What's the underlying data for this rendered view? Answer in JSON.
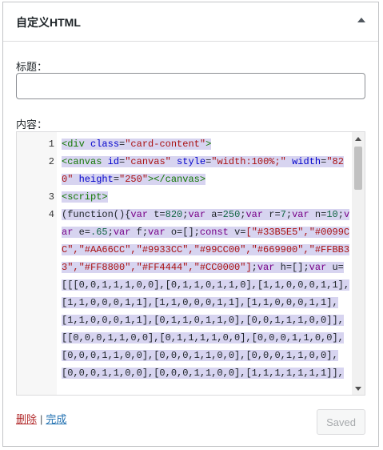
{
  "widget": {
    "title": "自定义HTML",
    "title_label": "标题：",
    "title_value": "",
    "content_label": "内容：",
    "delete_label": "删除",
    "separator": "|",
    "done_label": "完成",
    "saved_label": "Saved"
  },
  "editor": {
    "line_numbers": [
      "1",
      "2",
      "3",
      "4"
    ],
    "line1": {
      "open": "<",
      "tag": "div",
      "attr": "class",
      "eq": "=",
      "str": "\"card-content\"",
      "close": ">"
    },
    "line2": {
      "open": "<",
      "tag": "canvas",
      "attr1": "id",
      "eq1": "=",
      "str1": "\"canvas\"",
      "attr2": "style",
      "eq2": "=",
      "str2": "\"width:100%;\"",
      "attr3": "width",
      "eq3": "=",
      "str3": "\"820\"",
      "attr4": "height",
      "eq4": "=",
      "str4": "\"250\"",
      "close": ">",
      "end": "</canvas>"
    },
    "line3": {
      "text": "<script>"
    },
    "line4": {
      "a": "(function(){",
      "kw1": "var",
      "b": " t=",
      "n1": "820",
      "c": ";",
      "kw2": "var",
      "d": " a=",
      "n2": "250",
      "e": ";",
      "kw3": "var",
      "f": " r=",
      "n3": "7",
      "g": ";",
      "kw4": "var",
      "h": " n=",
      "n4": "10",
      "i": ";",
      "kw5": "var",
      "j": " e=",
      "n5": ".65",
      "k": ";",
      "kw6": "var",
      "l": " f;",
      "kw7": "var",
      "m": " o=[];",
      "kw8": "const",
      "o": " v=",
      "colors": "[\"#33B5E5\",\"#0099CC\",\"#AA66CC\",\"#9933CC\",\"#99CC00\",\"#669900\",\"#FFBB33\",\"#FF8800\",\"#FF4444\",\"#CC0000\"]",
      "p": ";",
      "kw9": "var",
      "q": " h=[];",
      "kw10": "var",
      "r": " u=[[[0,0,1,1,1,0,0],[0,1,1,0,1,1,0],[1,1,0,0,0,1,1],[1,1,0,0,0,1,1],[1,1,0,0,0,1,1],[1,1,0,0,0,1,1],[1,1,0,0,0,1,1],[0,1,1,0,1,1,0],[0,0,1,1,1,0,0]],[[0,0,0,1,1,0,0],[0,1,1,1,1,0,0],[0,0,0,1,1,0,0],[0,0,0,1,1,0,0],[0,0,0,1,1,0,0],[0,0,0,1,1,0,0],[0,0,0,1,1,0,0],[0,0,0,1,1,0,0],[1,1,1,1,1,1,1]],"
    }
  }
}
